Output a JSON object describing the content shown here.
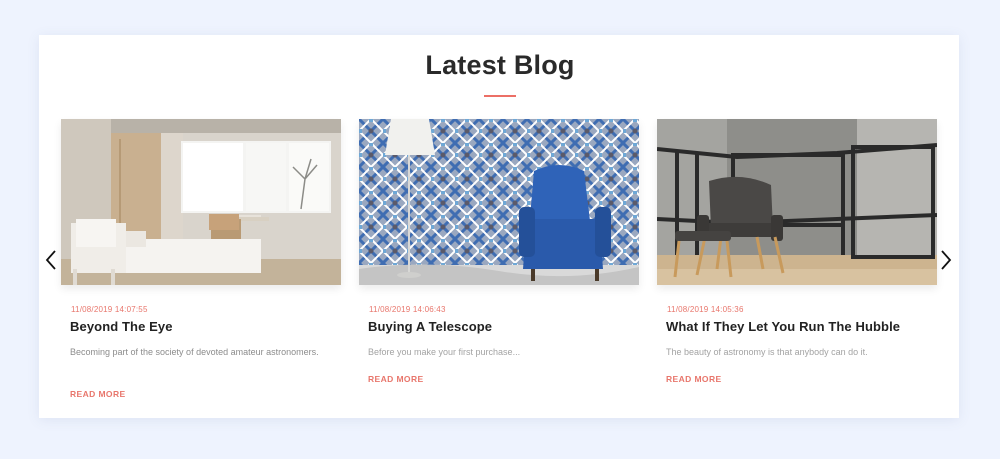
{
  "section": {
    "title": "Latest Blog",
    "accent_color": "#ec6f66"
  },
  "carousel": {
    "prev_icon": "chevron-left-icon",
    "next_icon": "chevron-right-icon"
  },
  "posts": [
    {
      "date": "11/08/2019 14:07:55",
      "title": "Beyond The Eye",
      "excerpt": "Becoming part of the society of devoted amateur astronomers.",
      "read_more": "READ MORE",
      "image": "bedroom-interior"
    },
    {
      "date": "11/08/2019 14:06:43",
      "title": "Buying A Telescope",
      "excerpt": "Before you make your first purchase...",
      "read_more": "READ MORE",
      "image": "blue-armchair-patterned-wall"
    },
    {
      "date": "11/08/2019 14:05:36",
      "title": "What If They Let You Run The Hubble",
      "excerpt": "The beauty of astronomy is that anybody can do it.",
      "read_more": "READ MORE",
      "image": "grey-chair-concrete-wall"
    }
  ]
}
